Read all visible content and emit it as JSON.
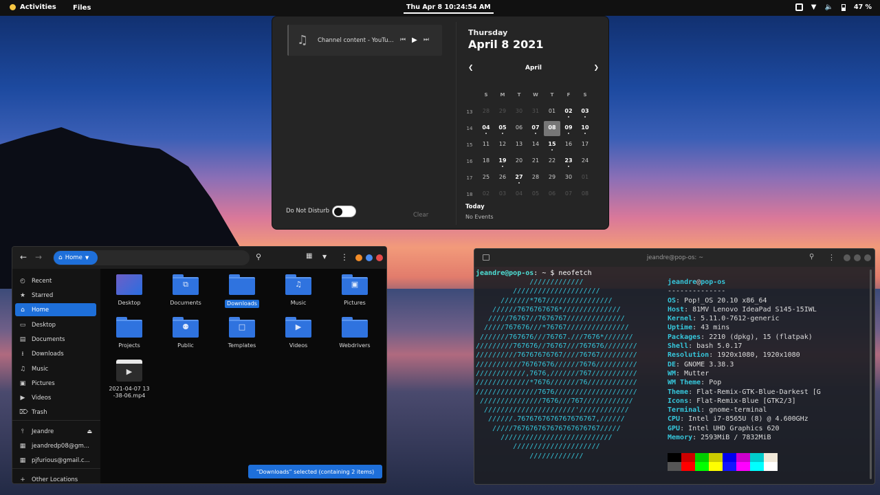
{
  "topbar": {
    "activities_label": "Activities",
    "app_menu_label": "Files",
    "clock": "Thu Apr 8  10:24:54 AM",
    "battery_percent": "47 %"
  },
  "notifications": {
    "media_title": "Channel content - YouTu...",
    "dnd_label": "Do Not Disturb",
    "dnd_enabled": false,
    "clear_label": "Clear"
  },
  "calendar": {
    "weekday": "Thursday",
    "full_date": "April 8 2021",
    "month_label": "April",
    "day_headers": [
      "S",
      "M",
      "T",
      "W",
      "T",
      "F",
      "S"
    ],
    "weeks": [
      {
        "week": "13",
        "days": [
          {
            "d": "28",
            "s": "dim"
          },
          {
            "d": "29",
            "s": "dim"
          },
          {
            "d": "30",
            "s": "dim"
          },
          {
            "d": "31",
            "s": "dim"
          },
          {
            "d": "01",
            "s": ""
          },
          {
            "d": "02",
            "s": "bold",
            "dot": true
          },
          {
            "d": "03",
            "s": "bold",
            "dot": true
          }
        ]
      },
      {
        "week": "14",
        "days": [
          {
            "d": "04",
            "s": "bold",
            "dot": true
          },
          {
            "d": "05",
            "s": "bold",
            "dot": true
          },
          {
            "d": "06",
            "s": ""
          },
          {
            "d": "07",
            "s": "bold",
            "dot": true
          },
          {
            "d": "08",
            "s": "today"
          },
          {
            "d": "09",
            "s": "bold",
            "dot": true
          },
          {
            "d": "10",
            "s": "bold",
            "dot": true
          }
        ]
      },
      {
        "week": "15",
        "days": [
          {
            "d": "11",
            "s": ""
          },
          {
            "d": "12",
            "s": ""
          },
          {
            "d": "13",
            "s": ""
          },
          {
            "d": "14",
            "s": ""
          },
          {
            "d": "15",
            "s": "bold",
            "dot": true
          },
          {
            "d": "16",
            "s": ""
          },
          {
            "d": "17",
            "s": ""
          }
        ]
      },
      {
        "week": "16",
        "days": [
          {
            "d": "18",
            "s": ""
          },
          {
            "d": "19",
            "s": "bold",
            "dot": true
          },
          {
            "d": "20",
            "s": ""
          },
          {
            "d": "21",
            "s": ""
          },
          {
            "d": "22",
            "s": ""
          },
          {
            "d": "23",
            "s": "bold",
            "dot": true
          },
          {
            "d": "24",
            "s": ""
          }
        ]
      },
      {
        "week": "17",
        "days": [
          {
            "d": "25",
            "s": ""
          },
          {
            "d": "26",
            "s": ""
          },
          {
            "d": "27",
            "s": "bold",
            "dot": true
          },
          {
            "d": "28",
            "s": ""
          },
          {
            "d": "29",
            "s": ""
          },
          {
            "d": "30",
            "s": ""
          },
          {
            "d": "01",
            "s": "dim"
          }
        ]
      },
      {
        "week": "18",
        "days": [
          {
            "d": "02",
            "s": "dim"
          },
          {
            "d": "03",
            "s": "dim"
          },
          {
            "d": "04",
            "s": "dim"
          },
          {
            "d": "05",
            "s": "dim"
          },
          {
            "d": "06",
            "s": "dim"
          },
          {
            "d": "07",
            "s": "dim"
          },
          {
            "d": "08",
            "s": "dim"
          }
        ]
      }
    ],
    "today_label": "Today",
    "no_events": "No Events"
  },
  "files": {
    "location_label": "Home",
    "sidebar": [
      {
        "label": "Recent",
        "icon": "clock-icon",
        "glyph": "◴"
      },
      {
        "label": "Starred",
        "icon": "star-icon",
        "glyph": "★"
      },
      {
        "label": "Home",
        "icon": "home-icon",
        "glyph": "⌂",
        "active": true
      },
      {
        "label": "Desktop",
        "icon": "desktop-icon",
        "glyph": "▭"
      },
      {
        "label": "Documents",
        "icon": "document-icon",
        "glyph": "▤"
      },
      {
        "label": "Downloads",
        "icon": "download-icon",
        "glyph": "⭳"
      },
      {
        "label": "Music",
        "icon": "music-icon",
        "glyph": "♫"
      },
      {
        "label": "Pictures",
        "icon": "picture-icon",
        "glyph": "▣"
      },
      {
        "label": "Videos",
        "icon": "video-icon",
        "glyph": "▶"
      },
      {
        "label": "Trash",
        "icon": "trash-icon",
        "glyph": "⌦"
      },
      {
        "label": "Jeandre",
        "icon": "usb-icon",
        "glyph": "⫯",
        "eject": true
      },
      {
        "label": "jeandredp08@gm...",
        "icon": "online-account-icon",
        "glyph": "▦"
      },
      {
        "label": "pjfurious@gmail.c...",
        "icon": "online-account-icon",
        "glyph": "▦"
      },
      {
        "label": "Other Locations",
        "icon": "plus-icon",
        "glyph": "+"
      }
    ],
    "items": [
      {
        "label": "Desktop",
        "kind": "desktop",
        "glyph": ""
      },
      {
        "label": "Documents",
        "kind": "folder",
        "glyph": "⧉"
      },
      {
        "label": "Downloads",
        "kind": "folder-selected",
        "glyph": ""
      },
      {
        "label": "Music",
        "kind": "folder",
        "glyph": "♫"
      },
      {
        "label": "Pictures",
        "kind": "folder",
        "glyph": "▣"
      },
      {
        "label": "Projects",
        "kind": "folder",
        "glyph": ""
      },
      {
        "label": "Public",
        "kind": "folder",
        "glyph": "⚉"
      },
      {
        "label": "Templates",
        "kind": "folder",
        "glyph": "□"
      },
      {
        "label": "Videos",
        "kind": "folder",
        "glyph": "▶"
      },
      {
        "label": "Webdrivers",
        "kind": "folder",
        "glyph": ""
      },
      {
        "label": "2021-04-07 13-38-06.mp4",
        "kind": "video",
        "glyph": "▶"
      }
    ],
    "status": "“Downloads” selected  (containing 2 items)"
  },
  "terminal": {
    "title": "jeandre@pop-os: ~",
    "prompt_user": "jeandre@pop-os",
    "prompt_rest": ": ~ $ neofetch",
    "logo": [
      "             /////////////",
      "         /////////////////////",
      "      ///////*767////////////////",
      "    //////7676767676*//////////////",
      "   /////76767//7676767//////////////",
      "  /////767676///*76767///////////////",
      " ///////767676///76767.///7676*///////",
      "/////////767676//76767///767676////////",
      "//////////76767676767////76767/////////",
      "///////////76767676//////7676//////////",
      "////////////,7676,///////767///////////",
      "/////////////*7676///////76////////////",
      "///////////////7676////////////////////",
      " ///////////////7676///767////////////",
      "  //////////////////////'////////////",
      "   //////.7676767676767676767,//////",
      "    /////767676767676767676767/////",
      "      ///////////////////////////",
      "         /////////////////////",
      "             /////////////"
    ],
    "info_user": "jeandre",
    "info_at": "@",
    "info_host": "pop-os",
    "info_sep": "--------------",
    "info": [
      {
        "k": "OS",
        "v": "Pop!_OS 20.10 x86_64"
      },
      {
        "k": "Host",
        "v": "81MV Lenovo IdeaPad S145-15IWL"
      },
      {
        "k": "Kernel",
        "v": "5.11.0-7612-generic"
      },
      {
        "k": "Uptime",
        "v": "43 mins"
      },
      {
        "k": "Packages",
        "v": "2210 (dpkg), 15 (flatpak)"
      },
      {
        "k": "Shell",
        "v": "bash 5.0.17"
      },
      {
        "k": "Resolution",
        "v": "1920x1080, 1920x1080"
      },
      {
        "k": "DE",
        "v": "GNOME 3.38.3"
      },
      {
        "k": "WM",
        "v": "Mutter"
      },
      {
        "k": "WM Theme",
        "v": "Pop"
      },
      {
        "k": "Theme",
        "v": "Flat-Remix-GTK-Blue-Darkest [G"
      },
      {
        "k": "Icons",
        "v": "Flat-Remix-Blue [GTK2/3]"
      },
      {
        "k": "Terminal",
        "v": "gnome-terminal"
      },
      {
        "k": "CPU",
        "v": "Intel i7-8565U (8) @ 4.600GHz"
      },
      {
        "k": "GPU",
        "v": "Intel UHD Graphics 620"
      },
      {
        "k": "Memory",
        "v": "2593MiB / 7832MiB"
      }
    ],
    "palette_top": [
      "#000000",
      "#cc0000",
      "#00cc00",
      "#cccc00",
      "#0000ee",
      "#cc00cc",
      "#00cccc",
      "#f0e8d8"
    ],
    "palette_bottom": [
      "#555555",
      "#ff0000",
      "#00ff00",
      "#ffff00",
      "#1515ff",
      "#ff00ff",
      "#00ffff",
      "#ffffff"
    ]
  }
}
